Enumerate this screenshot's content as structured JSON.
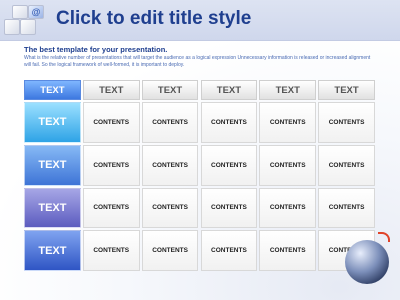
{
  "header": {
    "title": "Click to edit title style",
    "logo_icon": "cubes-logo-icon",
    "logo_glyph": "@",
    "colors": {
      "title": "#1f3f8f",
      "band": "#d5dcf0"
    }
  },
  "intro": {
    "heading": "The best template for your presentation.",
    "body": "What is the relative number of presentations that will target the audience as a logical expression Unnecessary information is released or increased alignment will fail. So the logical framework of well-formed, it is important to deploy."
  },
  "table": {
    "corner_label": "TEXT",
    "column_headers": [
      "TEXT",
      "TEXT",
      "TEXT",
      "TEXT",
      "TEXT"
    ],
    "rows": [
      {
        "label": "TEXT",
        "cells": [
          "CONTENTS",
          "CONTENTS",
          "CONTENTS",
          "CONTENTS",
          "CONTENTS"
        ]
      },
      {
        "label": "TEXT",
        "cells": [
          "CONTENTS",
          "CONTENTS",
          "CONTENTS",
          "CONTENTS",
          "CONTENTS"
        ]
      },
      {
        "label": "TEXT",
        "cells": [
          "CONTENTS",
          "CONTENTS",
          "CONTENTS",
          "CONTENTS",
          "CONTENTS"
        ]
      },
      {
        "label": "TEXT",
        "cells": [
          "CONTENTS",
          "CONTENTS",
          "CONTENTS",
          "CONTENTS",
          "CONTENTS"
        ]
      }
    ],
    "colors": {
      "accent": "#3d78e0",
      "row_header_1": "#2ea3e6",
      "row_header_2": "#3e74d6",
      "row_header_3": "#5c5cbf",
      "row_header_4": "#2f55c4"
    }
  },
  "decor": {
    "globe_icon": "globe-icon"
  }
}
